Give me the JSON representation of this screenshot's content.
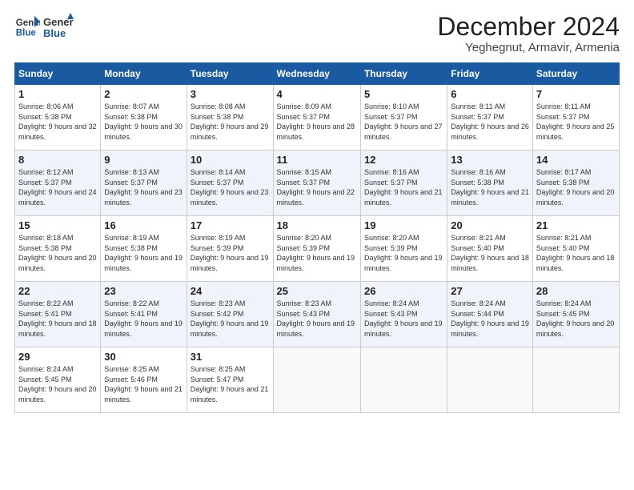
{
  "logo": {
    "line1": "General",
    "line2": "Blue"
  },
  "title": "December 2024",
  "location": "Yeghegnut, Armavir, Armenia",
  "days_header": [
    "Sunday",
    "Monday",
    "Tuesday",
    "Wednesday",
    "Thursday",
    "Friday",
    "Saturday"
  ],
  "weeks": [
    [
      {
        "day": "1",
        "sunrise": "8:06 AM",
        "sunset": "5:38 PM",
        "daylight": "9 hours and 32 minutes."
      },
      {
        "day": "2",
        "sunrise": "8:07 AM",
        "sunset": "5:38 PM",
        "daylight": "9 hours and 30 minutes."
      },
      {
        "day": "3",
        "sunrise": "8:08 AM",
        "sunset": "5:38 PM",
        "daylight": "9 hours and 29 minutes."
      },
      {
        "day": "4",
        "sunrise": "8:09 AM",
        "sunset": "5:37 PM",
        "daylight": "9 hours and 28 minutes."
      },
      {
        "day": "5",
        "sunrise": "8:10 AM",
        "sunset": "5:37 PM",
        "daylight": "9 hours and 27 minutes."
      },
      {
        "day": "6",
        "sunrise": "8:11 AM",
        "sunset": "5:37 PM",
        "daylight": "9 hours and 26 minutes."
      },
      {
        "day": "7",
        "sunrise": "8:11 AM",
        "sunset": "5:37 PM",
        "daylight": "9 hours and 25 minutes."
      }
    ],
    [
      {
        "day": "8",
        "sunrise": "8:12 AM",
        "sunset": "5:37 PM",
        "daylight": "9 hours and 24 minutes."
      },
      {
        "day": "9",
        "sunrise": "8:13 AM",
        "sunset": "5:37 PM",
        "daylight": "9 hours and 23 minutes."
      },
      {
        "day": "10",
        "sunrise": "8:14 AM",
        "sunset": "5:37 PM",
        "daylight": "9 hours and 23 minutes."
      },
      {
        "day": "11",
        "sunrise": "8:15 AM",
        "sunset": "5:37 PM",
        "daylight": "9 hours and 22 minutes."
      },
      {
        "day": "12",
        "sunrise": "8:16 AM",
        "sunset": "5:37 PM",
        "daylight": "9 hours and 21 minutes."
      },
      {
        "day": "13",
        "sunrise": "8:16 AM",
        "sunset": "5:38 PM",
        "daylight": "9 hours and 21 minutes."
      },
      {
        "day": "14",
        "sunrise": "8:17 AM",
        "sunset": "5:38 PM",
        "daylight": "9 hours and 20 minutes."
      }
    ],
    [
      {
        "day": "15",
        "sunrise": "8:18 AM",
        "sunset": "5:38 PM",
        "daylight": "9 hours and 20 minutes."
      },
      {
        "day": "16",
        "sunrise": "8:19 AM",
        "sunset": "5:38 PM",
        "daylight": "9 hours and 19 minutes."
      },
      {
        "day": "17",
        "sunrise": "8:19 AM",
        "sunset": "5:39 PM",
        "daylight": "9 hours and 19 minutes."
      },
      {
        "day": "18",
        "sunrise": "8:20 AM",
        "sunset": "5:39 PM",
        "daylight": "9 hours and 19 minutes."
      },
      {
        "day": "19",
        "sunrise": "8:20 AM",
        "sunset": "5:39 PM",
        "daylight": "9 hours and 19 minutes."
      },
      {
        "day": "20",
        "sunrise": "8:21 AM",
        "sunset": "5:40 PM",
        "daylight": "9 hours and 18 minutes."
      },
      {
        "day": "21",
        "sunrise": "8:21 AM",
        "sunset": "5:40 PM",
        "daylight": "9 hours and 18 minutes."
      }
    ],
    [
      {
        "day": "22",
        "sunrise": "8:22 AM",
        "sunset": "5:41 PM",
        "daylight": "9 hours and 18 minutes."
      },
      {
        "day": "23",
        "sunrise": "8:22 AM",
        "sunset": "5:41 PM",
        "daylight": "9 hours and 19 minutes."
      },
      {
        "day": "24",
        "sunrise": "8:23 AM",
        "sunset": "5:42 PM",
        "daylight": "9 hours and 19 minutes."
      },
      {
        "day": "25",
        "sunrise": "8:23 AM",
        "sunset": "5:43 PM",
        "daylight": "9 hours and 19 minutes."
      },
      {
        "day": "26",
        "sunrise": "8:24 AM",
        "sunset": "5:43 PM",
        "daylight": "9 hours and 19 minutes."
      },
      {
        "day": "27",
        "sunrise": "8:24 AM",
        "sunset": "5:44 PM",
        "daylight": "9 hours and 19 minutes."
      },
      {
        "day": "28",
        "sunrise": "8:24 AM",
        "sunset": "5:45 PM",
        "daylight": "9 hours and 20 minutes."
      }
    ],
    [
      {
        "day": "29",
        "sunrise": "8:24 AM",
        "sunset": "5:45 PM",
        "daylight": "9 hours and 20 minutes."
      },
      {
        "day": "30",
        "sunrise": "8:25 AM",
        "sunset": "5:46 PM",
        "daylight": "9 hours and 21 minutes."
      },
      {
        "day": "31",
        "sunrise": "8:25 AM",
        "sunset": "5:47 PM",
        "daylight": "9 hours and 21 minutes."
      },
      null,
      null,
      null,
      null
    ]
  ]
}
